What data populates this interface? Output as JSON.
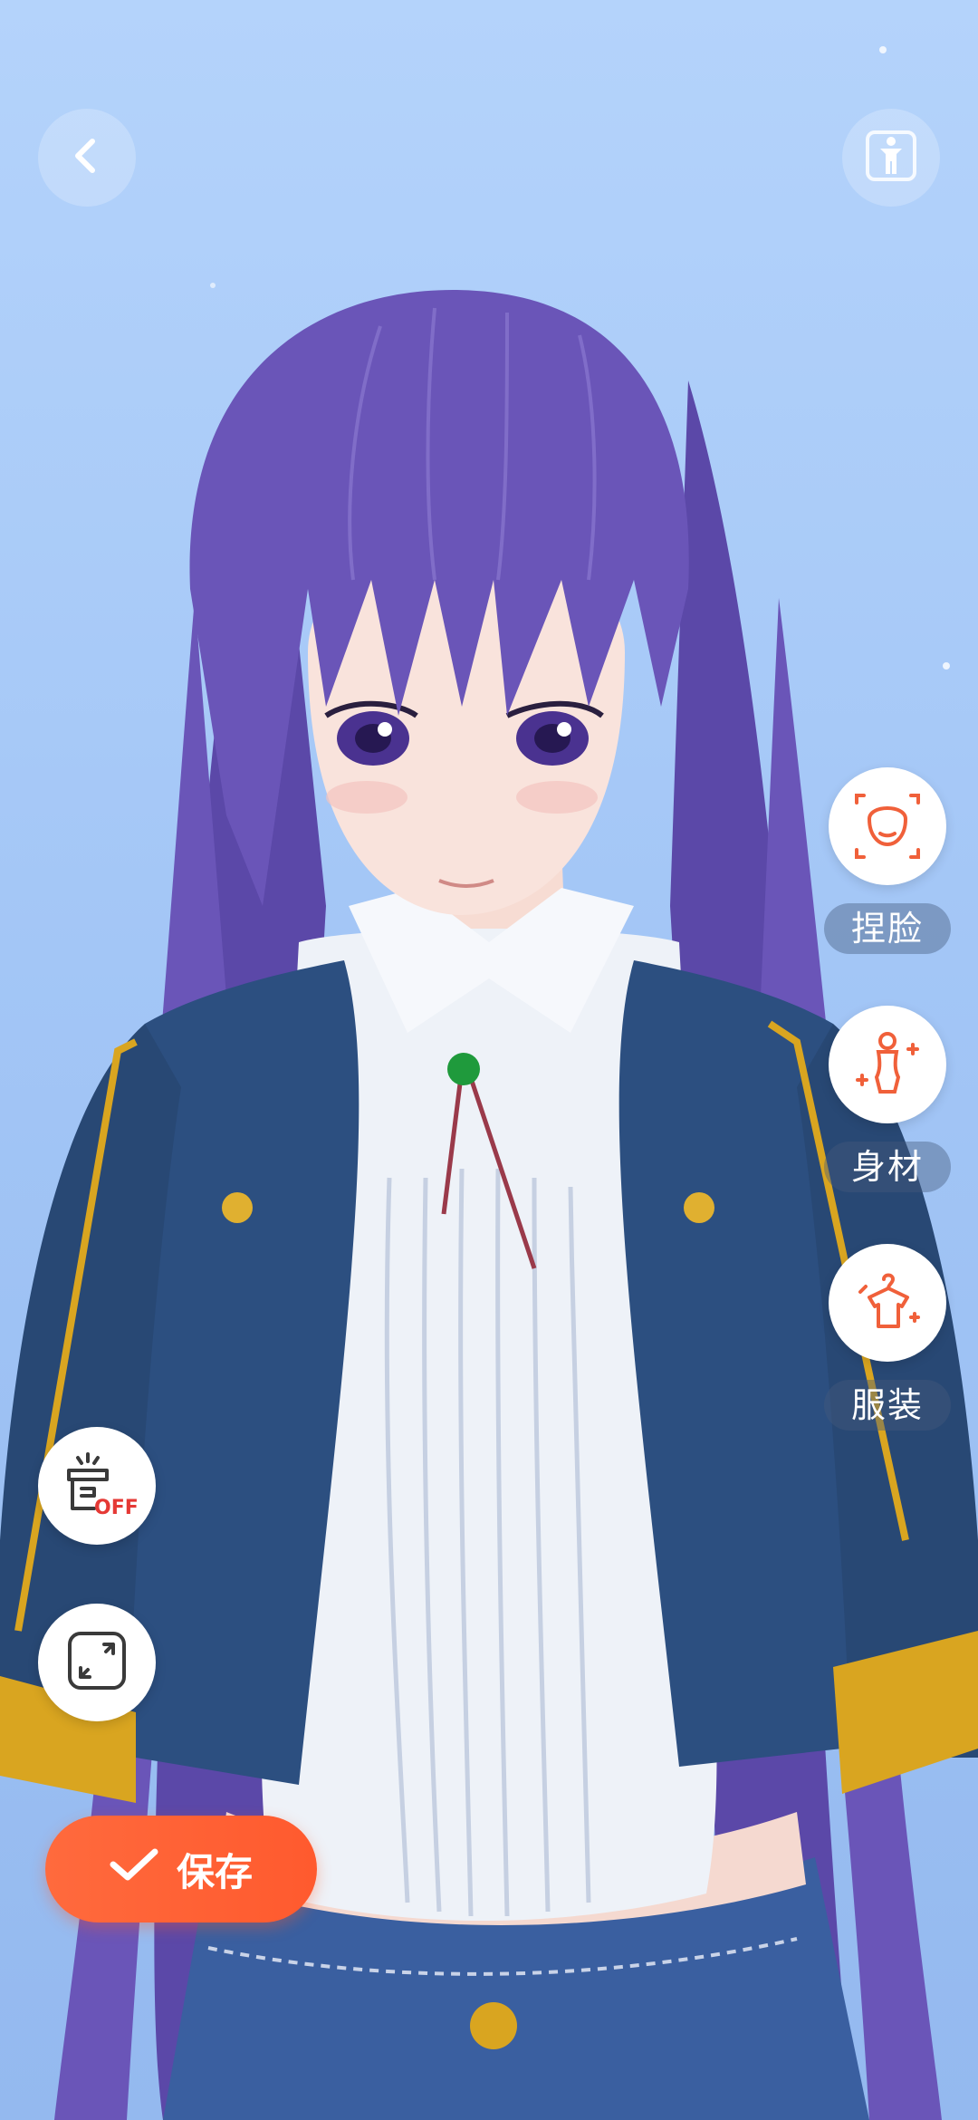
{
  "header": {
    "back_icon": "chevron-left-icon",
    "pose_icon": "standing-figure-icon"
  },
  "side_menu": [
    {
      "label": "捏脸",
      "icon": "face-shape-icon"
    },
    {
      "label": "身材",
      "icon": "body-shape-icon"
    },
    {
      "label": "服装",
      "icon": "clothing-hanger-icon"
    }
  ],
  "left_tools": {
    "gift_badge": "OFF",
    "gift_icon": "gift-box-off-icon",
    "expand_icon": "expand-arrows-icon"
  },
  "save_button": {
    "label": "保存",
    "icon": "check-icon"
  },
  "colors": {
    "accent": "#ff5a2e",
    "icon_orange": "#f0603a",
    "hair": "#6a55b8",
    "jacket": "#2c4f80",
    "shirt": "#eef2f8",
    "gold": "#d9a520"
  }
}
